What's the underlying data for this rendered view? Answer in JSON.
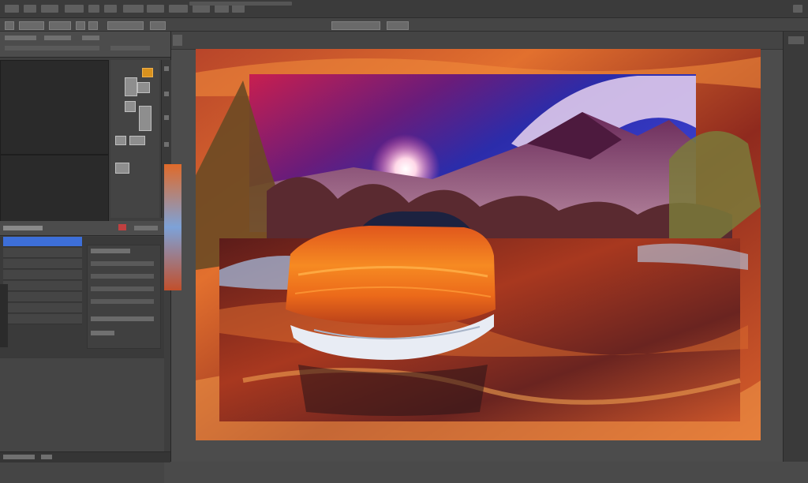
{
  "app": {
    "name": "photo-editor",
    "accent": "#3d6fd9"
  },
  "menubar": {
    "items_count": 14
  },
  "panels": {
    "layers_selected_index": 0
  },
  "colors": {
    "workspace": "#4c4c4c",
    "panel": "#3e3e3e",
    "selection": "#3d6fd9"
  },
  "icons": [
    "move-tool-icon",
    "eye-icon",
    "lock-icon",
    "swatch-icon"
  ]
}
